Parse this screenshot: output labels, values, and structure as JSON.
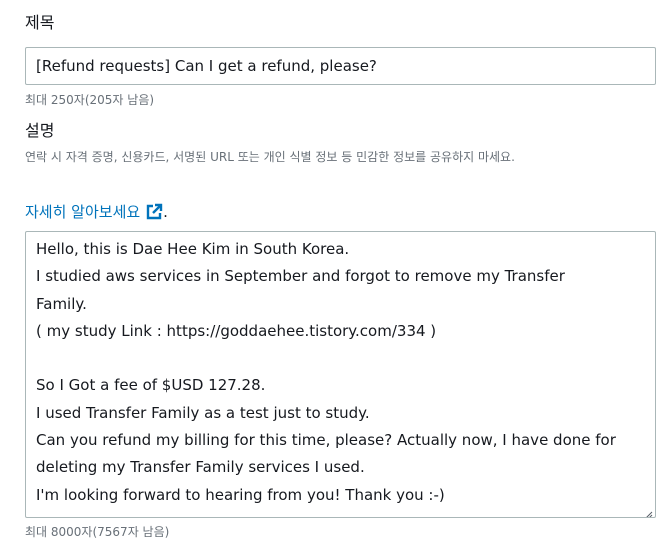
{
  "subject": {
    "label": "제목",
    "value": "[Refund requests] Can I get a refund, please?",
    "limit_hint": "최대 250자(205자 남음)"
  },
  "description": {
    "label": "설명",
    "warning": "연락 시 자격 증명, 신용카드, 서명된 URL 또는 개인 식별 정보 등 민감한 정보를 공유하지 마세요.",
    "learn_more": "자세히 알아보세요",
    "learn_more_period": ".",
    "lines": [
      "Hello, this is Dae Hee Kim in South Korea.",
      "I studied aws services in September and forgot to remove my Transfer",
      "Family.",
      "( my study Link : https://goddaehee.tistory.com/334 )",
      "",
      "So I Got a fee of $USD 127.28.",
      "I used Transfer Family as a test just to study.",
      "Can you refund my billing for this time, please? Actually now, I have done for",
      "deleting my Transfer Family services I used.",
      "I'm looking forward to hearing from you! Thank you :-)"
    ],
    "limit_hint": "최대 8000자(7567자 남음)"
  },
  "colors": {
    "link": "#0073bb",
    "hint": "#687078",
    "border": "#aab7b8",
    "text": "#16191f"
  },
  "icons": {
    "learn_more": "external-link-icon",
    "textarea_corner": "resize-grip-icon"
  }
}
